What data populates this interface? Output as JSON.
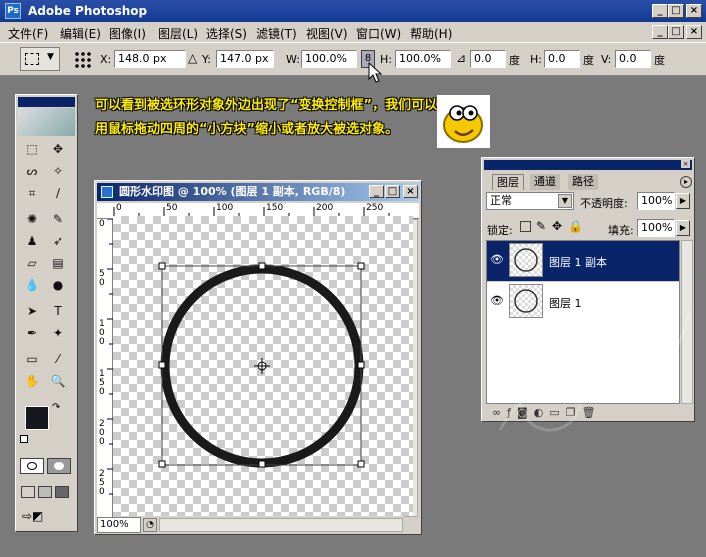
{
  "app": {
    "title": "Adobe Photoshop",
    "logo": "Ps"
  },
  "menu": [
    "文件(F)",
    "编辑(E)",
    "图像(I)",
    "图层(L)",
    "选择(S)",
    "滤镜(T)",
    "视图(V)",
    "窗口(W)",
    "帮助(H)"
  ],
  "options": {
    "x_label": "X:",
    "x_value": "148.0 px",
    "y_label": "Y:",
    "y_value": "147.0 px",
    "w_label": "W:",
    "w_value": "100.0%",
    "h_label": "H:",
    "h_value": "100.0%",
    "angle_value": "0.0",
    "angle_unit": "度",
    "hskew_label": "H:",
    "hskew_value": "0.0",
    "hskew_unit": "度",
    "vskew_label": "V:",
    "vskew_value": "0.0",
    "vskew_unit": "度"
  },
  "caption": "可以看到被选环形对象外边出现了“变换控制框”，我们可以用鼠标拖动四周的“小方块”缩小或者放大被选对象。",
  "document": {
    "title": "圆形水印图 @ 100% (图层 1 副本, RGB/8)",
    "zoom": "100%",
    "ruler_h": [
      "0",
      "50",
      "100",
      "150",
      "200",
      "250"
    ],
    "ruler_v": [
      "0",
      "50",
      "100",
      "150",
      "200",
      "250"
    ]
  },
  "layers_panel": {
    "tabs": [
      "图层",
      "通道",
      "路径"
    ],
    "blend_mode": "正常",
    "opacity_label": "不透明度:",
    "opacity_value": "100%",
    "lock_label": "锁定:",
    "fill_label": "填充:",
    "fill_value": "100%",
    "layers": [
      {
        "name": "图层 1 副本",
        "selected": true
      },
      {
        "name": "图层 1",
        "selected": false
      }
    ]
  },
  "colors": {
    "title_bar": "#123a91",
    "selection": "#0a246a",
    "ring": "#1a1a1a",
    "caption": "#ffee00"
  }
}
